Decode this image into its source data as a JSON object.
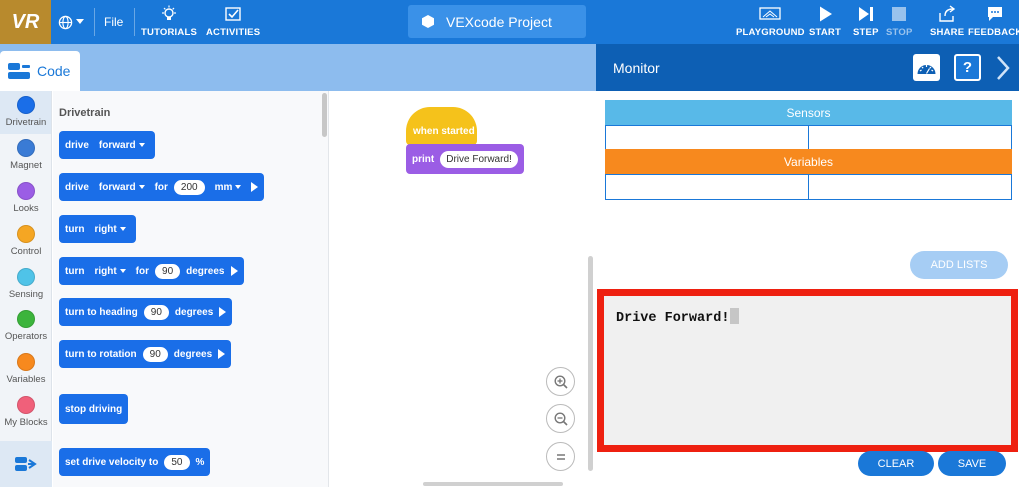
{
  "app": {
    "logo": "VR",
    "file_menu": "File",
    "project_name": "VEXcode Project"
  },
  "toolbar_left": [
    {
      "label": "TUTORIALS",
      "icon": "lightbulb-icon"
    },
    {
      "label": "ACTIVITIES",
      "icon": "checkbox-icon"
    }
  ],
  "toolbar_right": [
    {
      "label": "PLAYGROUND",
      "icon": "playground-icon"
    },
    {
      "label": "START",
      "icon": "play-icon"
    },
    {
      "label": "STEP",
      "icon": "step-icon"
    },
    {
      "label": "STOP",
      "icon": "stop-icon"
    },
    {
      "label": "SHARE",
      "icon": "share-icon"
    },
    {
      "label": "FEEDBACK",
      "icon": "feedback-icon"
    }
  ],
  "code_tab": "Code",
  "categories": [
    {
      "label": "Drivetrain",
      "color": "#1a6ee8"
    },
    {
      "label": "Magnet",
      "color": "#3a7bd5"
    },
    {
      "label": "Looks",
      "color": "#9b5de5"
    },
    {
      "label": "Control",
      "color": "#f5a623"
    },
    {
      "label": "Sensing",
      "color": "#4fc3e8"
    },
    {
      "label": "Operators",
      "color": "#3cb43c"
    },
    {
      "label": "Variables",
      "color": "#f7891e"
    },
    {
      "label": "My Blocks",
      "color": "#f0607a"
    }
  ],
  "palette": {
    "title": "Drivetrain",
    "blocks": [
      {
        "w1": "drive",
        "d1": "forward"
      },
      {
        "w1": "drive",
        "d1": "forward",
        "w2": "for",
        "n1": "200",
        "d2": "mm"
      },
      {
        "w1": "turn",
        "d1": "right"
      },
      {
        "w1": "turn",
        "d1": "right",
        "w2": "for",
        "n1": "90",
        "w3": "degrees"
      },
      {
        "w1": "turn to heading",
        "n1": "90",
        "w2": "degrees"
      },
      {
        "w1": "turn to rotation",
        "n1": "90",
        "w2": "degrees"
      },
      {
        "w1": "stop driving"
      },
      {
        "w1": "set drive velocity to",
        "n1": "50",
        "w2": "%"
      }
    ]
  },
  "workspace": {
    "hat_label": "when started",
    "print_label": "print",
    "print_value": "Drive Forward!"
  },
  "monitor": {
    "title": "Monitor",
    "help": "?",
    "sensors_header": "Sensors",
    "variables_header": "Variables",
    "sensors_color": "#58b9e8",
    "variables_color": "#f7891e",
    "add_lists": "ADD LISTS",
    "console_text": "Drive Forward!",
    "clear": "CLEAR",
    "save": "SAVE"
  }
}
